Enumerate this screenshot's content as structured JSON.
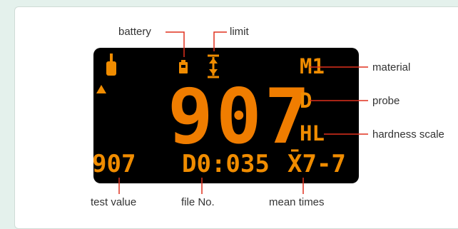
{
  "display": {
    "main_value": "907",
    "material": "M1",
    "probe": "D",
    "hardness_scale": "HL",
    "test_value": "907",
    "file_no": "D0:035",
    "mean_times": "X̄7-7"
  },
  "labels": {
    "battery": "battery",
    "limit": "limit",
    "material": "material",
    "probe": "probe",
    "hardness_scale": "hardness scale",
    "test_value": "test value",
    "file_no": "file No.",
    "mean_times": "mean times"
  },
  "colors": {
    "lcd_background": "#000000",
    "segment": "#f08c00",
    "leader_line": "#e0301e",
    "page_background": "#e4f1ec"
  }
}
